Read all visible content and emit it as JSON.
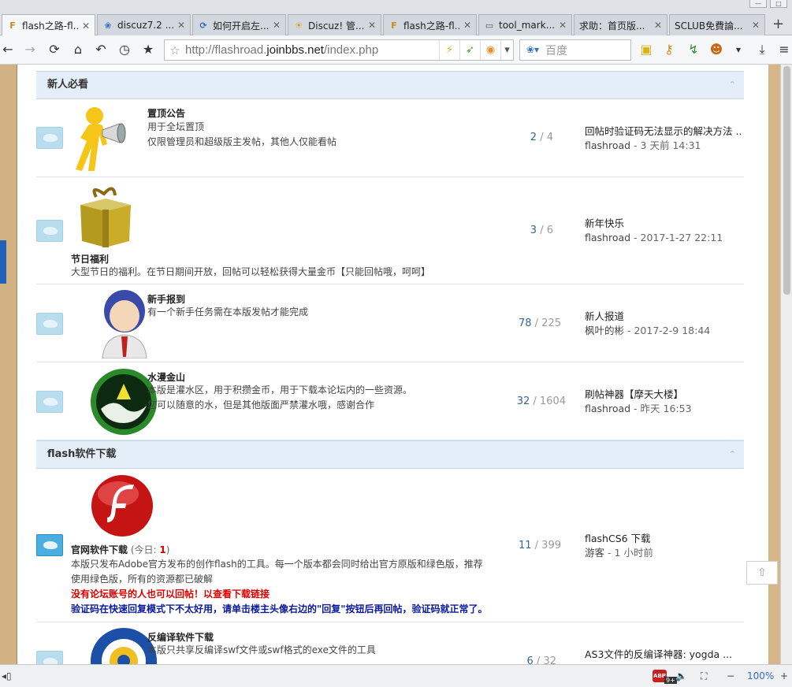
{
  "browser": {
    "tabs": [
      {
        "label": "flash之路-fl...",
        "icon": "F",
        "active": true
      },
      {
        "label": "discuz7.2 ...",
        "icon": "paw"
      },
      {
        "label": "如何开启左...",
        "icon": "refresh"
      },
      {
        "label": "Discuz! 管...",
        "icon": "bulb"
      },
      {
        "label": "flash之路-fl...",
        "icon": "F"
      },
      {
        "label": "tool_mark....",
        "icon": "tool"
      },
      {
        "label": "求助：首页版...",
        "icon": ""
      },
      {
        "label": "SCLUB免費論...",
        "icon": ""
      }
    ],
    "new_tab": "+",
    "url_host_prefix": "http://flashroad.",
    "url_domain": "joinbbs.net",
    "url_path": "/index.php",
    "search_placeholder": "百度",
    "zoom": "100%",
    "abp_count": "9+"
  },
  "categories": [
    {
      "title": "新人必看",
      "forums": [
        {
          "name": "置顶公告",
          "desc": [
            "用于全坛置顶",
            "仅限管理员和超级版主发帖，其他人仅能看帖"
          ],
          "threads": "2",
          "posts": "4",
          "last_title": "回帖时验证码无法显示的解决方法 ...",
          "last_by": "flashroad",
          "last_time": "3 天前 14:31",
          "icon": "megaphone-person"
        },
        {
          "name": "节日福利",
          "desc": [
            "大型节日的福利。在节日期间开放，回帖可以轻松获得大量金币【只能回帖哦，呵呵】"
          ],
          "threads": "3",
          "posts": "6",
          "last_title": "新年快乐",
          "last_by": "flashroad",
          "last_time": "2017-1-27 22:11",
          "icon": "gift-box"
        },
        {
          "name": "新手报到",
          "desc": [
            "有一个新手任务需在本版发帖才能完成"
          ],
          "threads": "78",
          "posts": "225",
          "last_title": "新人报道",
          "last_by": "枫叶的彬",
          "last_time": "2017-2-9 18:44",
          "icon": "user-avatar"
        },
        {
          "name": "水漫金山",
          "desc": [
            "本版是灌水区，用于积攒金币，用于下载本论坛内的一些资源。",
            "您可以随意的水，但是其他版面严禁灌水哦，感谢合作"
          ],
          "threads": "32",
          "posts": "1604",
          "last_title": "刷帖神器【摩天大楼】",
          "last_by": "flashroad",
          "last_time": "昨天 16:53",
          "icon": "water-emblem"
        }
      ]
    },
    {
      "title": "flash软件下载",
      "forums": [
        {
          "name": "官网软件下载",
          "today_label": " (今日: ",
          "today_count": "1",
          "today_close": ")",
          "desc": [
            "本版只发布Adobe官方发布的创作flash的工具。每一个版本都会同时给出官方原版和绿色版，推荐",
            "使用绿色版，所有的资源都已破解"
          ],
          "notice_red": "没有论坛账号的人也可以回帖！以查看下载链接",
          "notice_blue": "验证码在快速回复模式下不太好用，请单击楼主头像右边的\"回复\"按钮后再回帖，验证码就正常了。",
          "threads": "11",
          "posts": "399",
          "last_title": "flashCS6 下载",
          "last_by": "游客",
          "last_time": "1 小时前",
          "icon": "flash-logo"
        },
        {
          "name": "反编译软件下载",
          "desc": [
            "本版只共享反编译swf文件或swf格式的exe文件的工具"
          ],
          "threads": "6",
          "posts": "32",
          "last_title": "AS3文件的反编译神器: yogda ...",
          "icon": "gear-emblem"
        }
      ]
    }
  ],
  "separator": " / ",
  "dash": " - "
}
